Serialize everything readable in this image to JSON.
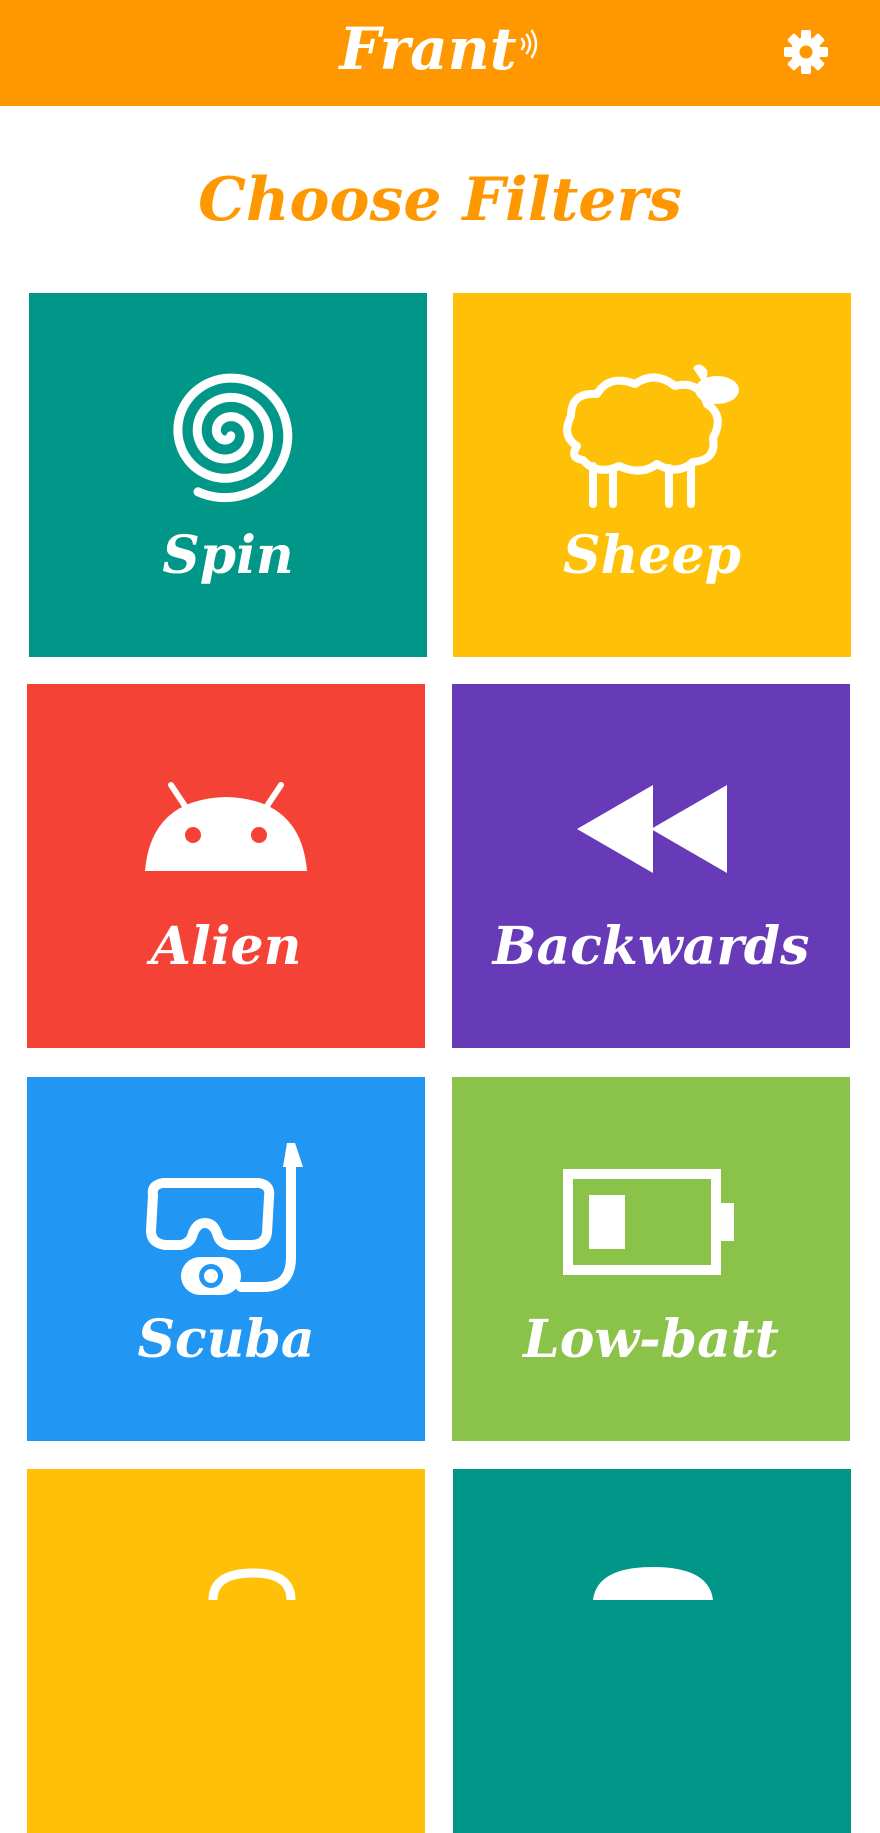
{
  "app": {
    "title": "Frant",
    "bar_color": "#ff9800",
    "settings_icon": "gear-icon"
  },
  "page": {
    "heading": "Choose Filters"
  },
  "filters": [
    {
      "label": "Spin",
      "icon": "spiral-icon",
      "color": "#009688"
    },
    {
      "label": "Sheep",
      "icon": "sheep-icon",
      "color": "#ffc107"
    },
    {
      "label": "Alien",
      "icon": "android-icon",
      "color": "#f44336"
    },
    {
      "label": "Backwards",
      "icon": "rewind-icon",
      "color": "#673ab7"
    },
    {
      "label": "Scuba",
      "icon": "snorkel-mask-icon",
      "color": "#2196f3"
    },
    {
      "label": "Low-batt",
      "icon": "low-battery-icon",
      "color": "#8bc34a"
    },
    {
      "label": "",
      "icon": "partial-icon",
      "color": "#ffc107"
    },
    {
      "label": "",
      "icon": "partial-icon",
      "color": "#009688"
    }
  ]
}
